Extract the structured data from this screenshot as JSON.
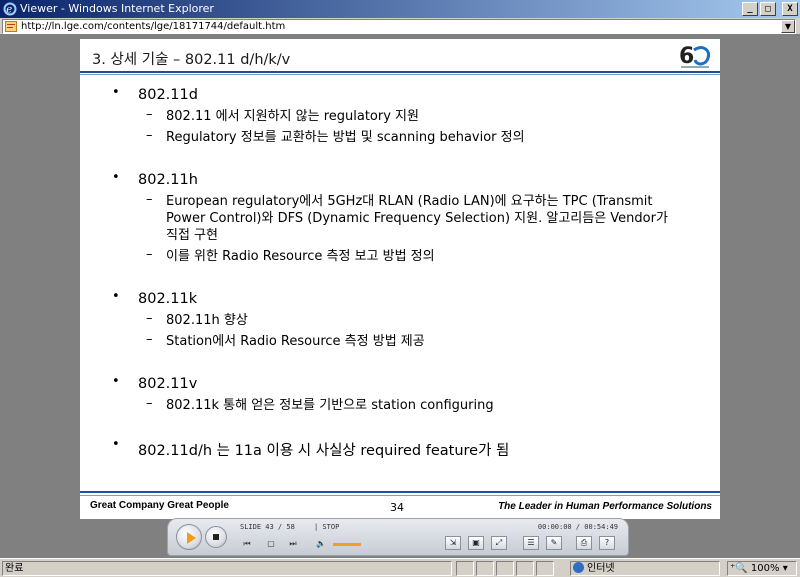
{
  "window": {
    "title": "Viewer - Windows Internet Explorer",
    "minimize": "_",
    "maximize": "□",
    "close": "X"
  },
  "address": {
    "url": "http://ln.lge.com/contents/lge/18171744/default.htm"
  },
  "slide": {
    "title": "3. 상세 기술 – 802.11 d/h/k/v",
    "bullets": [
      {
        "label": "802.11d",
        "subs": [
          "802.11 에서 지원하지 않는 regulatory 지원",
          "Regulatory 정보를 교환하는 방법 및 scanning behavior 정의"
        ]
      },
      {
        "label": "802.11h",
        "subs": [
          "European regulatory에서 5GHz대 RLAN (Radio LAN)에 요구하는 TPC (Transmit Power Control)와 DFS (Dynamic Frequency Selection) 지원. 알고리듬은 Vendor가 직접 구현",
          "이를 위한 Radio Resource 측정 보고 방법 정의"
        ]
      },
      {
        "label": "802.11k",
        "subs": [
          "802.11h 향상",
          "Station에서 Radio Resource 측정 방법 제공"
        ]
      },
      {
        "label": "802.11v",
        "subs": [
          "802.11k 통해 얻은 정보를 기반으로 station configuring"
        ]
      },
      {
        "label": "802.11d/h 는 11a 이용 시 사실상 required feature가 됨",
        "subs": []
      }
    ],
    "footer_left": "Great Company   Great People",
    "page_number": "34",
    "footer_right": "The Leader in Human Performance Solutions"
  },
  "player": {
    "slide_counter": "SLIDE 43 / 58",
    "status": "| STOP",
    "time": "00:00:00 / 00:54:49",
    "volume_fraction": 0.7
  },
  "statusbar": {
    "left": "완료",
    "zone": "인터넷",
    "zoom": "100%"
  }
}
